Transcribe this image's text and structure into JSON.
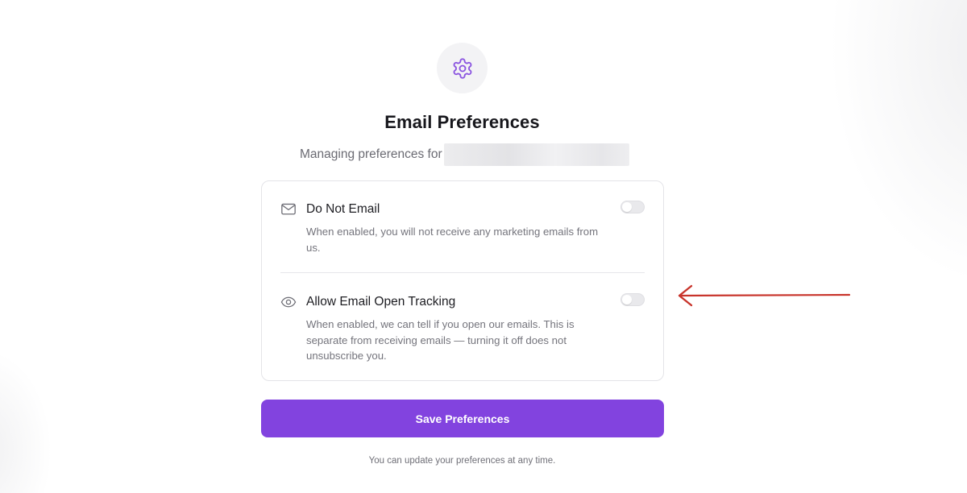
{
  "page": {
    "title": "Email Preferences",
    "subtitle_prefix": "Managing preferences for",
    "icon": "gear-icon",
    "accent_color": "#8243df"
  },
  "preferences": [
    {
      "icon": "mail-icon",
      "label": "Do Not Email",
      "description": "When enabled, you will not receive any marketing emails from us.",
      "enabled": false
    },
    {
      "icon": "eye-icon",
      "label": "Allow Email Open Tracking",
      "description": "When enabled, we can tell if you open our emails. This is separate from receiving emails — turning it off does not unsubscribe you.",
      "enabled": false
    }
  ],
  "actions": {
    "save_label": "Save Preferences"
  },
  "footer": {
    "note": "You can update your preferences at any time."
  },
  "annotation": {
    "arrow_color": "#c8342b"
  }
}
